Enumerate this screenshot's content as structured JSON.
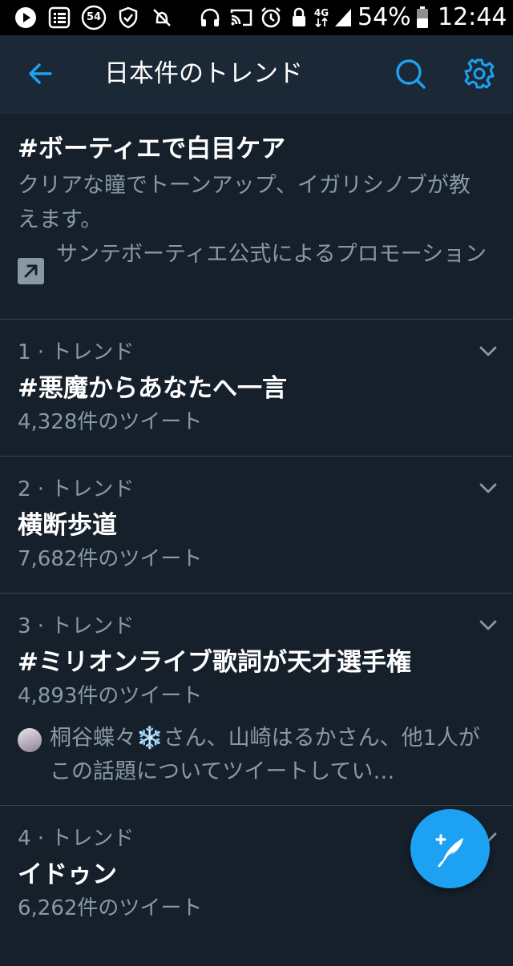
{
  "status_bar": {
    "battery_percent": "54%",
    "time": "12:44",
    "notification_badge": "54",
    "network_label": "4G",
    "icons": [
      "play-icon",
      "list-icon",
      "badge-54-icon",
      "shield-icon",
      "alarm-off-icon",
      "headphones-icon",
      "cast-icon",
      "alarm-icon",
      "lock-icon",
      "network-4g-icon",
      "signal-icon",
      "battery-icon"
    ]
  },
  "app_bar": {
    "title": "日本件のトレンド",
    "accent_color": "#1da1f2"
  },
  "promoted": {
    "title": "#ボーティエで白目ケア",
    "description": "クリアな瞳でトーンアップ、イガリシノブが教えます。",
    "promoted_by": "サンテボーティエ公式によるプロモーション"
  },
  "trends": [
    {
      "meta": "1 · トレンド",
      "name": "#悪魔からあなたへ一言",
      "count": "4,328件のツイート"
    },
    {
      "meta": "2 · トレンド",
      "name": "横断歩道",
      "count": "7,682件のツイート"
    },
    {
      "meta": "3 · トレンド",
      "name": "#ミリオンライブ歌詞が天才選手権",
      "count": "4,893件のツイート",
      "context": "桐谷蝶々❄️さん、山崎はるかさん、他1人がこの話題についてツイートしてい…"
    },
    {
      "meta": "4 · トレンド",
      "name": "イドゥン",
      "count": "6,262件のツイート"
    }
  ]
}
